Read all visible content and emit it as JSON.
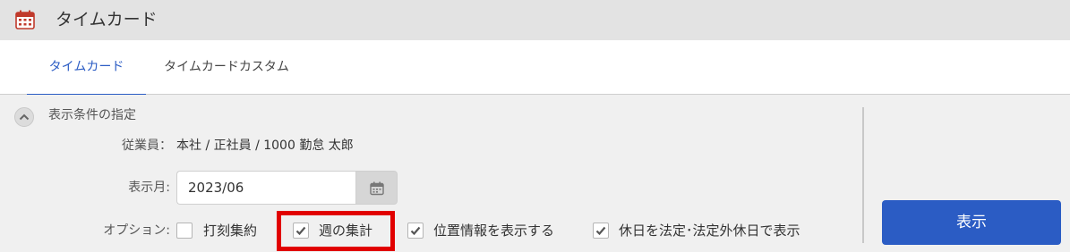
{
  "app": {
    "title": "タイムカード",
    "icon": "calendar-icon"
  },
  "tabs": [
    {
      "label": "タイムカード",
      "active": true
    },
    {
      "label": "タイムカードカスタム",
      "active": false
    }
  ],
  "conditions": {
    "title": "表示条件の指定",
    "employee_label": "従業員：",
    "employee_value": "本社 / 正社員 / 1000 勤怠 太郎",
    "month_label": "表示月:",
    "month_value": "2023/06",
    "options_label": "オプション:",
    "options": [
      {
        "label": "打刻集約",
        "checked": false
      },
      {
        "label": "週の集計",
        "checked": true,
        "highlighted": true
      },
      {
        "label": "位置情報を表示する",
        "checked": true
      },
      {
        "label": "休日を法定･法定外休日で表示",
        "checked": true
      }
    ]
  },
  "show_button": {
    "label": "表示"
  },
  "colors": {
    "accent": "#2b5cc4",
    "highlight": "#e10000",
    "icon_red": "#c0392b"
  }
}
